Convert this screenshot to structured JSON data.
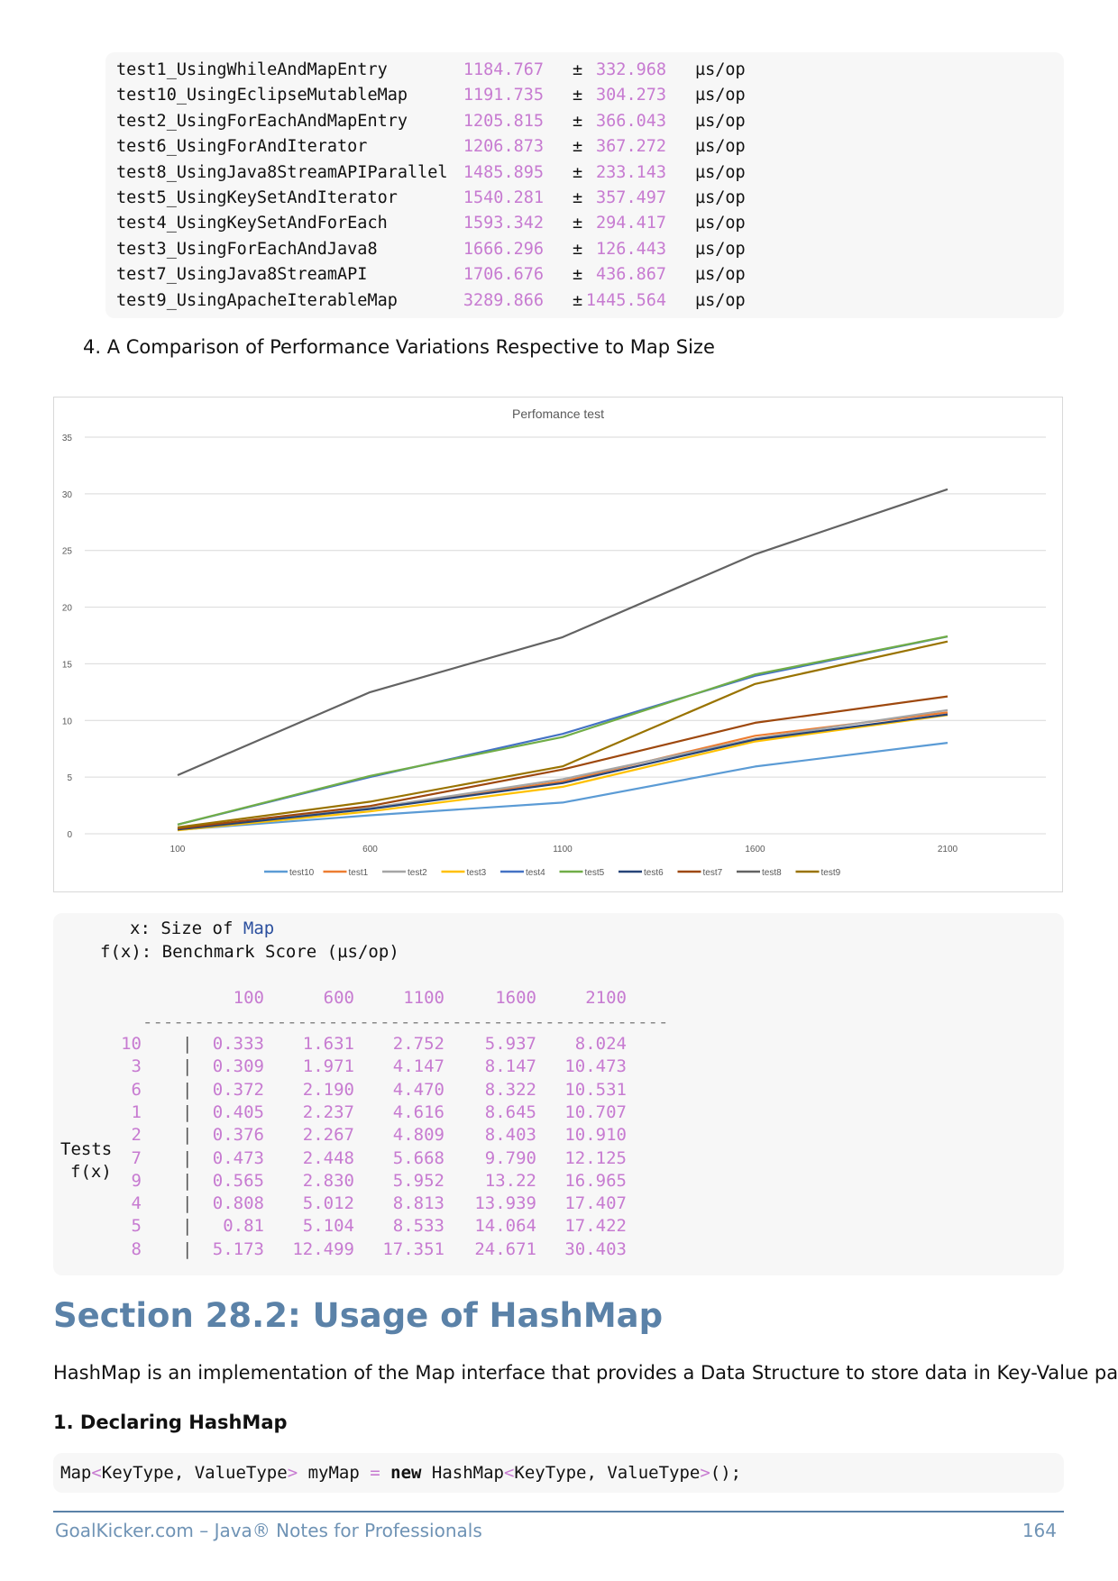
{
  "benchmark": {
    "pm": "±",
    "rows": [
      {
        "name": "test1_UsingWhileAndMapEntry",
        "score": "1184.767",
        "error": "332.968",
        "unit": "µs/op"
      },
      {
        "name": "test10_UsingEclipseMutableMap",
        "score": "1191.735",
        "error": "304.273",
        "unit": "µs/op"
      },
      {
        "name": "test2_UsingForEachAndMapEntry",
        "score": "1205.815",
        "error": "366.043",
        "unit": "µs/op"
      },
      {
        "name": "test6_UsingForAndIterator",
        "score": "1206.873",
        "error": "367.272",
        "unit": "µs/op"
      },
      {
        "name": "test8_UsingJava8StreamAPIParallel",
        "score": "1485.895",
        "error": "233.143",
        "unit": "µs/op"
      },
      {
        "name": "test5_UsingKeySetAndIterator",
        "score": "1540.281",
        "error": "357.497",
        "unit": "µs/op"
      },
      {
        "name": "test4_UsingKeySetAndForEach",
        "score": "1593.342",
        "error": "294.417",
        "unit": "µs/op"
      },
      {
        "name": "test3_UsingForEachAndJava8",
        "score": "1666.296",
        "error": "126.443",
        "unit": "µs/op"
      },
      {
        "name": "test7_UsingJava8StreamAPI",
        "score": "1706.676",
        "error": "436.867",
        "unit": "µs/op"
      },
      {
        "name": "test9_UsingApacheIterableMap",
        "score": "3289.866",
        "error": "1445.564",
        "unit": "µs/op"
      }
    ]
  },
  "list_item": "4.  A Comparison of Performance Variations Respective to Map Size",
  "chart_data": {
    "type": "line",
    "title": "Perfomance test",
    "x": [
      100,
      600,
      1100,
      1600,
      2100
    ],
    "x_tick_labels": [
      "100",
      "600",
      "1100",
      "1600",
      "2100"
    ],
    "ylim": [
      0,
      35
    ],
    "y_ticks": [
      0,
      5,
      10,
      15,
      20,
      25,
      30,
      35
    ],
    "grid": true,
    "legend_position": "bottom",
    "series": [
      {
        "name": "test10",
        "color": "#5b9bd5",
        "values": [
          0.333,
          1.631,
          2.752,
          5.937,
          8.024
        ]
      },
      {
        "name": "test1",
        "color": "#ed7d31",
        "values": [
          0.405,
          2.237,
          4.616,
          8.645,
          10.707
        ]
      },
      {
        "name": "test2",
        "color": "#a5a5a5",
        "values": [
          0.376,
          2.267,
          4.809,
          8.403,
          10.91
        ]
      },
      {
        "name": "test3",
        "color": "#ffc000",
        "values": [
          0.309,
          1.971,
          4.147,
          8.147,
          10.473
        ]
      },
      {
        "name": "test4",
        "color": "#4472c4",
        "values": [
          0.808,
          5.012,
          8.813,
          13.939,
          17.407
        ]
      },
      {
        "name": "test5",
        "color": "#70ad47",
        "values": [
          0.81,
          5.104,
          8.533,
          14.064,
          17.422
        ]
      },
      {
        "name": "test6",
        "color": "#264478",
        "values": [
          0.372,
          2.19,
          4.47,
          8.322,
          10.531
        ]
      },
      {
        "name": "test7",
        "color": "#9e480e",
        "values": [
          0.473,
          2.448,
          5.668,
          9.79,
          12.125
        ]
      },
      {
        "name": "test8",
        "color": "#636363",
        "values": [
          5.173,
          12.499,
          17.351,
          24.671,
          30.403
        ]
      },
      {
        "name": "test9",
        "color": "#997300",
        "values": [
          0.565,
          2.83,
          5.952,
          13.22,
          16.965
        ]
      }
    ]
  },
  "table": {
    "x_line_label": "x",
    "x_line_text": "Size of",
    "x_line_kw": "Map",
    "f_line_label": "f(x)",
    "f_line_text": "Benchmark Score (µs/op)",
    "headers": [
      "100",
      "600",
      "1100",
      "1600",
      "2100"
    ],
    "divider": "---------------------------------------------------",
    "row_label_1": "Tests",
    "row_label_2": "f(x)",
    "rows": [
      {
        "id": "10",
        "values": [
          "0.333",
          "1.631",
          "2.752",
          "5.937",
          "8.024"
        ]
      },
      {
        "id": "3",
        "values": [
          "0.309",
          "1.971",
          "4.147",
          "8.147",
          "10.473"
        ]
      },
      {
        "id": "6",
        "values": [
          "0.372",
          "2.190",
          "4.470",
          "8.322",
          "10.531"
        ]
      },
      {
        "id": "1",
        "values": [
          "0.405",
          "2.237",
          "4.616",
          "8.645",
          "10.707"
        ]
      },
      {
        "id": "2",
        "values": [
          "0.376",
          "2.267",
          "4.809",
          "8.403",
          "10.910"
        ]
      },
      {
        "id": "7",
        "values": [
          "0.473",
          "2.448",
          "5.668",
          "9.790",
          "12.125"
        ]
      },
      {
        "id": "9",
        "values": [
          "0.565",
          "2.830",
          "5.952",
          "13.22",
          "16.965"
        ]
      },
      {
        "id": "4",
        "values": [
          "0.808",
          "5.012",
          "8.813",
          "13.939",
          "17.407"
        ]
      },
      {
        "id": "5",
        "values": [
          "0.81",
          "5.104",
          "8.533",
          "14.064",
          "17.422"
        ]
      },
      {
        "id": "8",
        "values": [
          "5.173",
          "12.499",
          "17.351",
          "24.671",
          "30.403"
        ]
      }
    ]
  },
  "section_title": "Section 28.2: Usage of HashMap",
  "intro": "HashMap is an implementation of the Map interface that provides a Data Structure to store data in Key-Value pairs.",
  "subheading": "1. Declaring HashMap",
  "code": {
    "p1": "Map",
    "lt1": "<",
    "p2": "KeyType, ValueType",
    "gt1": ">",
    "p3": " myMap ",
    "eq": "=",
    "p4": " ",
    "kw_new": "new",
    "p5": " HashMap",
    "lt2": "<",
    "p6": "KeyType, ValueType",
    "gt2": ">",
    "p7": "();"
  },
  "footer": {
    "left": "GoalKicker.com – Java® Notes for Professionals",
    "page": "164"
  }
}
